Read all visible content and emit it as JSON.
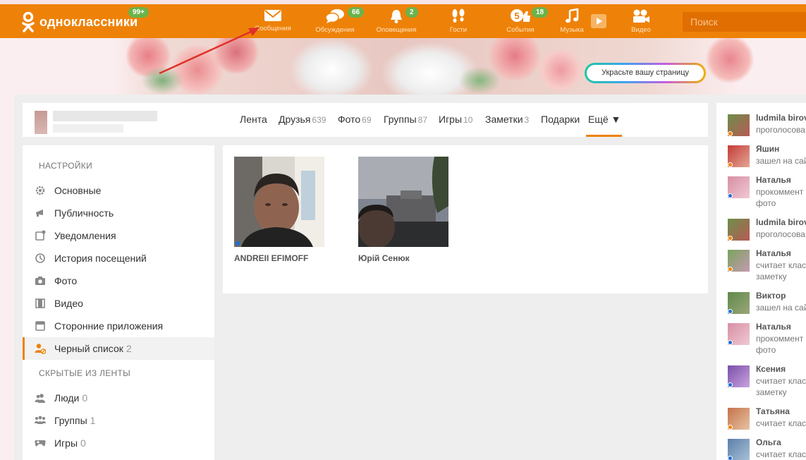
{
  "topbar": {
    "logo_text": "одноклассники",
    "logo_badge": "99+",
    "nav": [
      {
        "label": "Сообщения",
        "badge": "",
        "icon": "envelope-icon"
      },
      {
        "label": "Обсуждения",
        "badge": "66",
        "icon": "chat-bubbles-icon"
      },
      {
        "label": "Оповещения",
        "badge": "2",
        "icon": "bell-icon"
      },
      {
        "label": "Гости",
        "badge": "",
        "icon": "footprints-icon"
      },
      {
        "label": "События",
        "badge": "18",
        "icon": "events-icon"
      },
      {
        "label": "Музыка",
        "badge": "",
        "icon": "music-note-icon"
      },
      {
        "label": "Видео",
        "badge": "",
        "icon": "video-camera-icon"
      }
    ],
    "search_placeholder": "Поиск",
    "accent": "#ee8208"
  },
  "banner": {
    "decorate_label": "Украсьте вашу страницу"
  },
  "tabs": [
    {
      "label": "Лента",
      "count": ""
    },
    {
      "label": "Друзья",
      "count": "639"
    },
    {
      "label": "Фото",
      "count": "69"
    },
    {
      "label": "Группы",
      "count": "87"
    },
    {
      "label": "Игры",
      "count": "10"
    },
    {
      "label": "Заметки",
      "count": "3"
    },
    {
      "label": "Подарки",
      "count": ""
    },
    {
      "label": "Ещё ▼",
      "count": ""
    }
  ],
  "sidebar": {
    "settings_title": "НАСТРОЙКИ",
    "settings_items": [
      {
        "label": "Основные",
        "count": "",
        "icon": "gear-icon"
      },
      {
        "label": "Публичность",
        "count": "",
        "icon": "megaphone-icon"
      },
      {
        "label": "Уведомления",
        "count": "",
        "icon": "notification-icon"
      },
      {
        "label": "История посещений",
        "count": "",
        "icon": "history-icon"
      },
      {
        "label": "Фото",
        "count": "",
        "icon": "camera-icon"
      },
      {
        "label": "Видео",
        "count": "",
        "icon": "film-icon"
      },
      {
        "label": "Сторонние приложения",
        "count": "",
        "icon": "app-window-icon"
      },
      {
        "label": "Черный список",
        "count": "2",
        "icon": "blocked-user-icon"
      }
    ],
    "hidden_title": "СКРЫТЫЕ ИЗ ЛЕНТЫ",
    "hidden_items": [
      {
        "label": "Люди",
        "count": "0",
        "icon": "people-icon"
      },
      {
        "label": "Группы",
        "count": "1",
        "icon": "groups-icon"
      },
      {
        "label": "Игры",
        "count": "0",
        "icon": "gamepad-icon"
      }
    ]
  },
  "blacklist": [
    {
      "name": "ANDREII EFIMOFF",
      "online": true
    },
    {
      "name": "Юрій Сенюк",
      "online": false
    }
  ],
  "feed": [
    {
      "name": "ludmila birov",
      "action": [
        "проголосова"
      ],
      "dot": "#ee8208"
    },
    {
      "name": "Яшин",
      "action": [
        "зашел на сай"
      ],
      "dot": "#ee8208"
    },
    {
      "name": "Наталья",
      "action": [
        "прокоммент",
        "фото"
      ],
      "dot": "#1a6ed8"
    },
    {
      "name": "ludmila birov",
      "action": [
        "проголосова"
      ],
      "dot": "#ee8208"
    },
    {
      "name": "Наталья",
      "action": [
        "считает клас",
        "заметку"
      ],
      "dot": "#ee8208"
    },
    {
      "name": "Виктор",
      "action": [
        "зашел на сай"
      ],
      "dot": "#1a6ed8"
    },
    {
      "name": "Наталья",
      "action": [
        "прокоммент",
        "фото"
      ],
      "dot": "#1a6ed8"
    },
    {
      "name": "Ксения",
      "action": [
        "считает клас",
        "заметку"
      ],
      "dot": "#1a6ed8"
    },
    {
      "name": "Татьяна",
      "action": [
        "считает клас"
      ],
      "dot": "#ee8208"
    },
    {
      "name": "Ольга",
      "action": [
        "считает клас"
      ],
      "dot": "#1a6ed8"
    }
  ]
}
